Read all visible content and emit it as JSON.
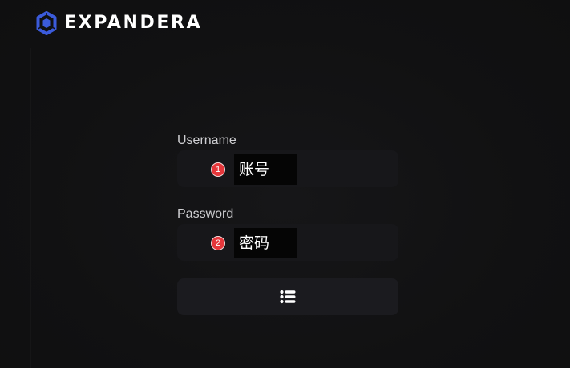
{
  "brand": {
    "name": "EXPANDERA",
    "logo_icon": "hexagon-logo-icon",
    "accent_color": "#3b5bdb"
  },
  "form": {
    "username": {
      "label": "Username",
      "marker": "1",
      "placeholder": "账号"
    },
    "password": {
      "label": "Password",
      "marker": "2",
      "placeholder": "密码"
    },
    "submit": {
      "icon": "list-icon"
    }
  },
  "colors": {
    "background": "#111112",
    "field": "#17171a",
    "marker": "#e5373b"
  }
}
